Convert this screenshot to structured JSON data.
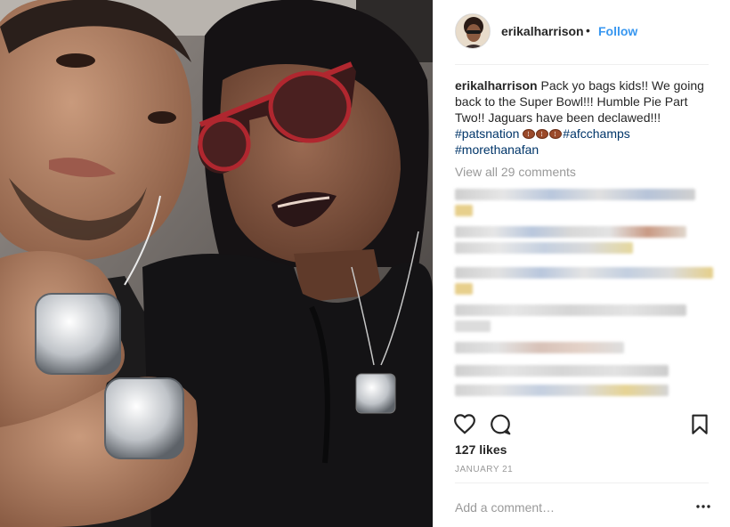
{
  "post": {
    "username": "erikalharrison",
    "separator": "•",
    "follow_label": "Follow",
    "caption": {
      "user": "erikalharrison",
      "text": "Pack yo bags kids!! We going back to the Super Bowl!!! Humble Pie Part Two!! Jaguars have been declawed!!!",
      "hashtag_1": "#patsnation",
      "emoji": "football-emoji",
      "hashtag_2": "#afcchamps",
      "hashtag_3": "#morethanafan"
    },
    "view_all_comments": "View all 29 comments",
    "likes": "127 likes",
    "date": "JANUARY 21",
    "comment_placeholder": "Add a comment…"
  },
  "icons": {
    "like": "heart-icon",
    "comment": "speech-bubble-icon",
    "save": "bookmark-icon",
    "more": "more-options-icon"
  },
  "colors": {
    "follow": "#3897f0",
    "hashtag": "#003569",
    "muted": "#999999",
    "text": "#262626"
  }
}
